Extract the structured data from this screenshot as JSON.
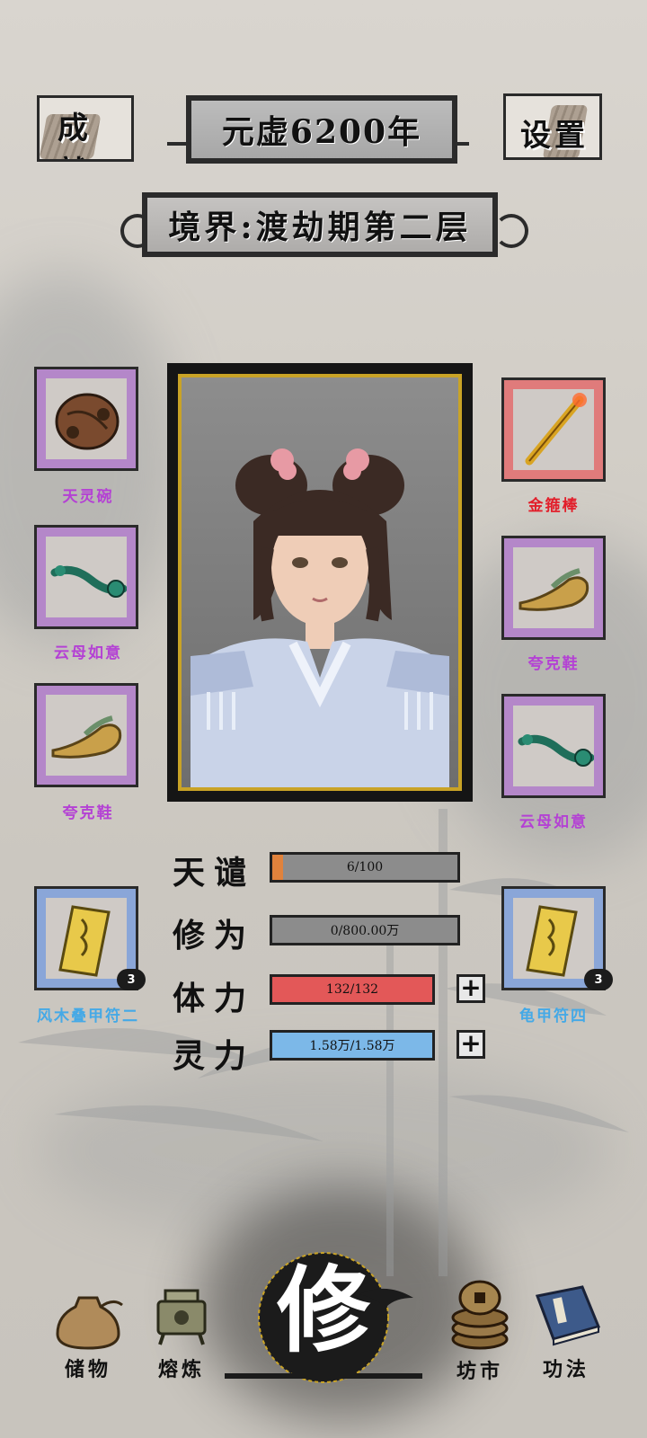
{
  "header": {
    "achievements_label": "成就",
    "year_label": "元虚6200年",
    "settings_label": "设置",
    "realm_label": "境界:渡劫期第二层"
  },
  "equipment": {
    "left": [
      {
        "name": "天灵碗",
        "rarity": "purple",
        "icon": "bowl-icon"
      },
      {
        "name": "云母如意",
        "rarity": "purple",
        "icon": "ruyi-icon"
      },
      {
        "name": "夸克鞋",
        "rarity": "purple",
        "icon": "shoe-icon"
      },
      {
        "name": "风木叠甲符二",
        "rarity": "blue",
        "icon": "talisman-icon",
        "count": "3"
      }
    ],
    "right": [
      {
        "name": "金箍棒",
        "rarity": "red",
        "icon": "staff-icon"
      },
      {
        "name": "夸克鞋",
        "rarity": "purple",
        "icon": "shoe-icon"
      },
      {
        "name": "云母如意",
        "rarity": "purple",
        "icon": "ruyi-icon"
      },
      {
        "name": "龟甲符四",
        "rarity": "blue",
        "icon": "talisman-icon",
        "count": "3"
      }
    ]
  },
  "stats": {
    "tribulation": {
      "label": "天谴",
      "value": "6/100",
      "fraction": 0.06,
      "color": "#e0823c"
    },
    "cultivation": {
      "label": "修为",
      "value": "0/800.00万",
      "fraction": 0.0,
      "color": "#8c8c8c"
    },
    "stamina": {
      "label": "体力",
      "value": "132/132",
      "fraction": 1.0,
      "color": "#e35858"
    },
    "spirit": {
      "label": "灵力",
      "value": "1.58万/1.58万",
      "fraction": 1.0,
      "color": "#7cb8e8"
    }
  },
  "nav": {
    "storage": "储物",
    "refine": "熔炼",
    "cultivate": "修",
    "market": "坊市",
    "skills": "功法"
  },
  "colors": {
    "purple_frame": "#b487c9",
    "red_frame": "#e07b7b",
    "blue_frame": "#8aa6d8",
    "gold_border": "#c9a326"
  }
}
